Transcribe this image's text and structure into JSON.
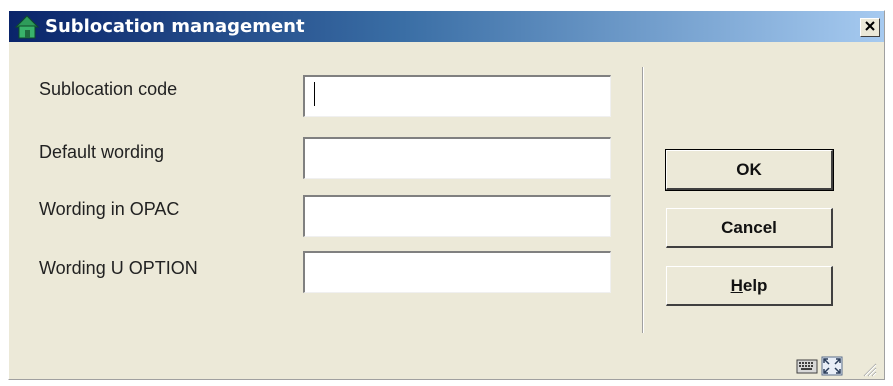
{
  "window": {
    "title": "Sublocation management",
    "close_label": "×"
  },
  "form": {
    "fields": [
      {
        "label": "Sublocation code",
        "value": ""
      },
      {
        "label": "Default wording",
        "value": ""
      },
      {
        "label": "Wording in OPAC",
        "value": ""
      },
      {
        "label": "Wording U OPTION",
        "value": ""
      }
    ]
  },
  "buttons": {
    "ok": "OK",
    "cancel": "Cancel",
    "help_mnemonic": "H",
    "help_rest": "elp"
  },
  "icons": {
    "app": "house-icon",
    "close": "close-icon",
    "keyboard": "keyboard-icon",
    "maximize": "maximize-icon",
    "resize": "resize-grip-icon"
  }
}
